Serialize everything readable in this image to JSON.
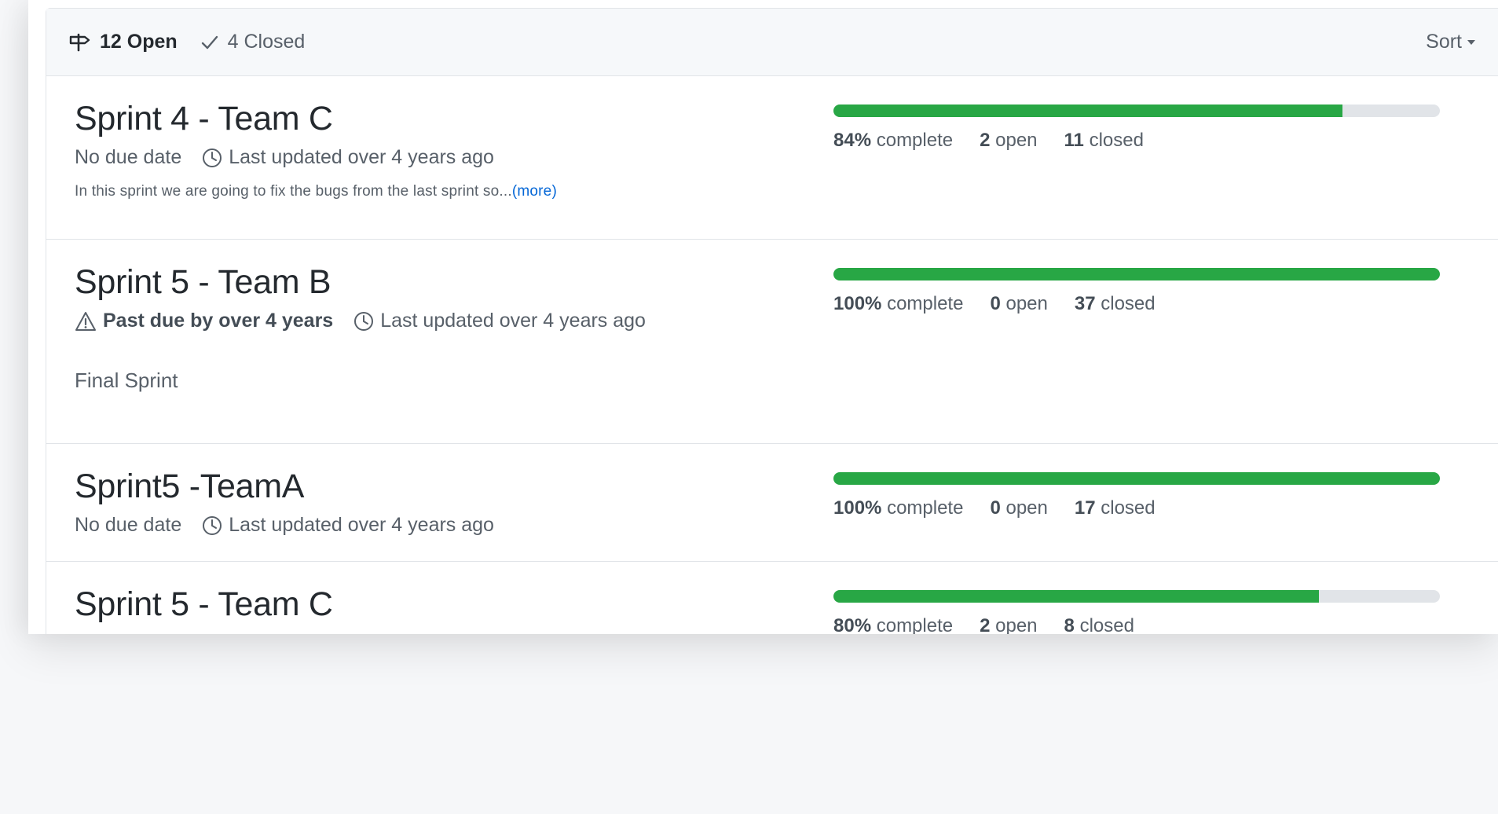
{
  "header": {
    "open_count": "12 Open",
    "closed_count": "4 Closed",
    "sort_label": "Sort"
  },
  "colors": {
    "progress_green": "#28a745",
    "progress_track": "#e1e4e8",
    "link_blue": "#0366d6"
  },
  "milestones": [
    {
      "title": "Sprint 4 - Team C",
      "due": "No due date",
      "updated": "Last updated over 4 years ago",
      "description": "In this sprint we are going to fix the bugs from the last sprint so...",
      "more_label": "(more)",
      "percent": 84,
      "percent_label": "84%",
      "open": "2",
      "closed": "11"
    },
    {
      "title": "Sprint 5 - Team B",
      "due": "Past due by over 4 years",
      "updated": "Last updated over 4 years ago",
      "description": "Final Sprint",
      "percent": 100,
      "percent_label": "100%",
      "open": "0",
      "closed": "37"
    },
    {
      "title": "Sprint5 -TeamA",
      "due": "No due date",
      "updated": "Last updated over 4 years ago",
      "percent": 100,
      "percent_label": "100%",
      "open": "0",
      "closed": "17"
    },
    {
      "title": "Sprint 5 - Team C",
      "percent": 80,
      "percent_label": "80%",
      "open": "2",
      "closed": "8"
    }
  ],
  "labels": {
    "complete": "complete",
    "open": "open",
    "closed": "closed"
  }
}
